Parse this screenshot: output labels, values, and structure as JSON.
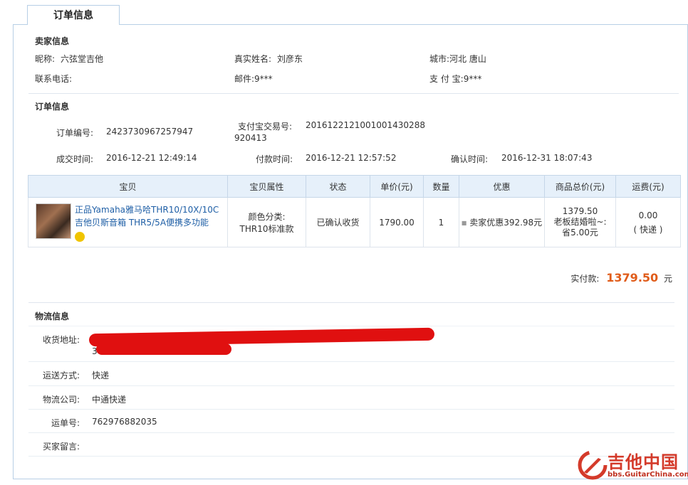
{
  "tab": {
    "label": "订单信息"
  },
  "seller": {
    "title": "卖家信息",
    "nickname_label": "昵称:",
    "nickname": "六弦堂吉他",
    "realname_label": "真实姓名:",
    "realname": "刘彦东",
    "city_label": "城市:",
    "city": "河北 唐山",
    "phone_label": "联系电话:",
    "phone": "",
    "email_label": "邮件:",
    "email": "9***",
    "alipay_label": "支 付 宝:",
    "alipay": "9***"
  },
  "order": {
    "title": "订单信息",
    "number_label": "订单编号:",
    "number": "2423730967257947",
    "alipay_trade_label": "支付宝交易号:",
    "alipay_trade_line1": "201612212100100143028​8",
    "alipay_trade_line2": "920413",
    "deal_time_label": "成交时间:",
    "deal_time": "2016-12-21 12:49:14",
    "pay_time_label": "付款时间:",
    "pay_time": "2016-12-21 12:57:52",
    "confirm_time_label": "确认时间:",
    "confirm_time": "2016-12-31 18:07:43"
  },
  "table": {
    "headers": [
      "宝贝",
      "宝贝属性",
      "状态",
      "单价(元)",
      "数量",
      "优惠",
      "商品总价(元)",
      "运费(元)"
    ],
    "item": {
      "title_line1": "正品Yamaha雅马哈THR10/10X/10C",
      "title_line2": "吉他贝斯音箱 THR5/5A便携多功能",
      "attr_line1": "颜色分类:",
      "attr_line2": "THR10标准款",
      "status": "已确认收货",
      "price": "1790.00",
      "qty": "1",
      "discount": "卖家优惠392.98元",
      "total_line1": "1379.50",
      "total_line2": "老板结婚啦~:",
      "total_line3": "省5.00元",
      "shipping_line1": "0.00",
      "shipping_line2": "( 快递 )"
    }
  },
  "payment": {
    "label": "实付款:",
    "amount": "1379.50",
    "unit": "元"
  },
  "logistics": {
    "title": "物流信息",
    "address_label": "收货地址:",
    "address_partial": "3",
    "method_label": "运送方式:",
    "method": "快递",
    "company_label": "物流公司:",
    "company": "中通快递",
    "tracking_label": "运单号:",
    "tracking": "762976882035",
    "message_label": "买家留言:",
    "message": ""
  },
  "watermark": {
    "name": "吉他中国",
    "url": "bbs.GuitarChina.com"
  },
  "colors": {
    "accent": "#1f5fa6",
    "price": "#e05c1a",
    "header_bg": "#e6f0fa",
    "border": "#b7cfe6",
    "redact": "#e01010"
  }
}
